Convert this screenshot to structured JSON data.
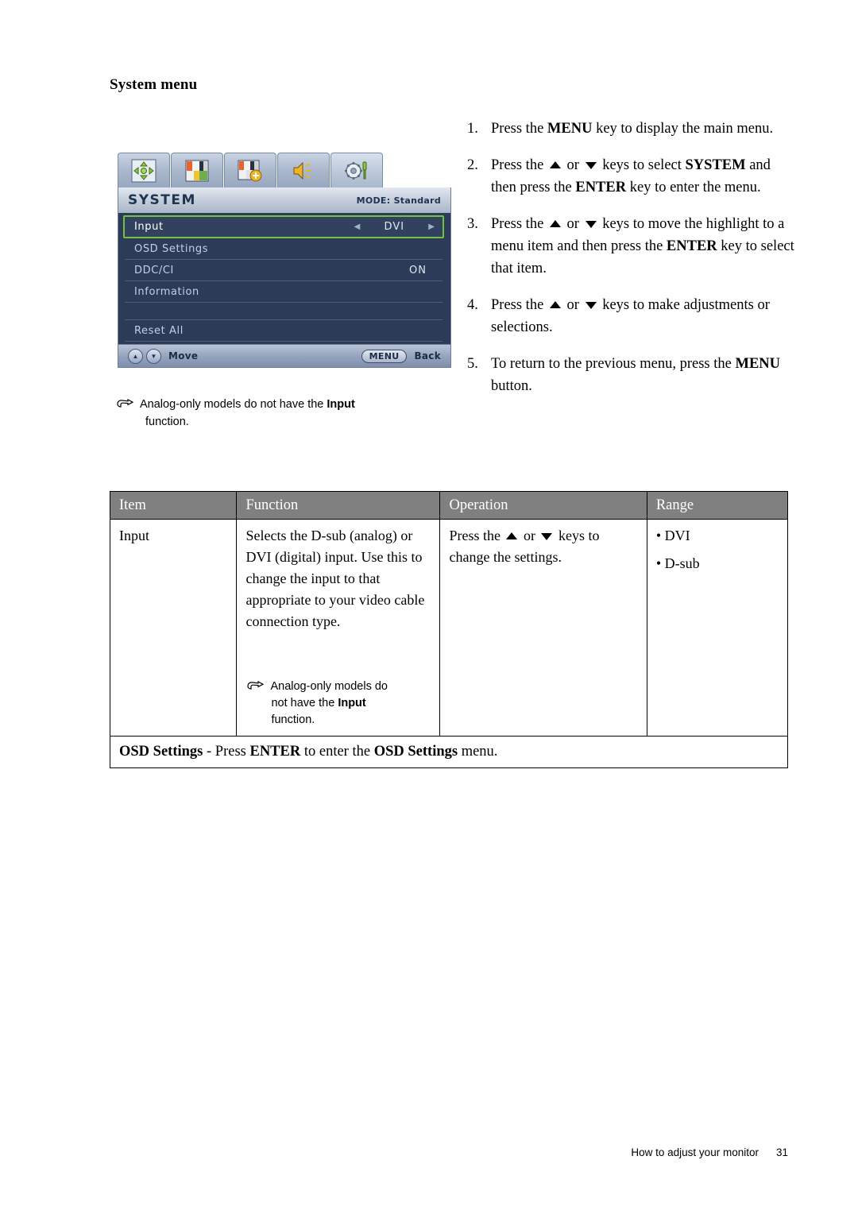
{
  "page": {
    "heading": "System menu",
    "footer_text": "How to adjust your monitor",
    "footer_page": "31"
  },
  "osd": {
    "tabs": [
      {
        "name": "display-position-icon",
        "label": "Display"
      },
      {
        "name": "picture-icon",
        "label": "Picture"
      },
      {
        "name": "picture-advanced-icon",
        "label": "Picture Advanced"
      },
      {
        "name": "audio-icon",
        "label": "Audio"
      },
      {
        "name": "system-icon",
        "label": "System"
      }
    ],
    "title": "SYSTEM",
    "mode": "MODE: Standard",
    "rows": [
      {
        "label": "Input",
        "value": "DVI",
        "selected": true,
        "arrows": true
      },
      {
        "label": "OSD Settings",
        "value": "",
        "selected": false,
        "arrows": false
      },
      {
        "label": "DDC/CI",
        "value": "ON",
        "selected": false,
        "arrows": false
      },
      {
        "label": "Information",
        "value": "",
        "selected": false,
        "arrows": false
      },
      {
        "label": "",
        "value": "",
        "selected": false,
        "arrows": false
      },
      {
        "label": "Reset All",
        "value": "",
        "selected": false,
        "arrows": false
      }
    ],
    "footer": {
      "up_glyph": "▲",
      "down_glyph": "▼",
      "move_label": "Move",
      "menu_label": "MENU",
      "back_label": "Back"
    },
    "colors": {
      "body_bg": "#2c3c58",
      "highlight": "#74c043",
      "text": "#c3cfe4"
    }
  },
  "note_under_image": {
    "line1_a": "Analog-only models do not have the ",
    "line1_bold": "Input",
    "line2": "function."
  },
  "steps": [
    {
      "num": "1.",
      "parts": [
        {
          "t": "Press the ",
          "s": "n"
        },
        {
          "t": "MENU",
          "s": "b"
        },
        {
          "t": " key to display the main menu.",
          "s": "n"
        }
      ]
    },
    {
      "num": "2.",
      "parts": [
        {
          "t": "Press the ",
          "s": "n"
        },
        {
          "t": "",
          "s": "up"
        },
        {
          "t": " or ",
          "s": "n"
        },
        {
          "t": "",
          "s": "dn"
        },
        {
          "t": " keys to select ",
          "s": "n"
        },
        {
          "t": "SYSTEM",
          "s": "b"
        },
        {
          "t": " and then press the ",
          "s": "n"
        },
        {
          "t": "ENTER",
          "s": "b"
        },
        {
          "t": " key to enter the menu.",
          "s": "n"
        }
      ]
    },
    {
      "num": "3.",
      "parts": [
        {
          "t": "Press the ",
          "s": "n"
        },
        {
          "t": "",
          "s": "up"
        },
        {
          "t": " or ",
          "s": "n"
        },
        {
          "t": "",
          "s": "dn"
        },
        {
          "t": " keys to move the highlight to a menu item and then press the ",
          "s": "n"
        },
        {
          "t": "ENTER",
          "s": "b"
        },
        {
          "t": " key to select that item.",
          "s": "n"
        }
      ]
    },
    {
      "num": "4.",
      "parts": [
        {
          "t": "Press the ",
          "s": "n"
        },
        {
          "t": "",
          "s": "up"
        },
        {
          "t": " or ",
          "s": "n"
        },
        {
          "t": "",
          "s": "dn"
        },
        {
          "t": " keys to make adjustments or selections.",
          "s": "n"
        }
      ]
    },
    {
      "num": "5.",
      "parts": [
        {
          "t": "To return to the previous menu, press the ",
          "s": "n"
        },
        {
          "t": "MENU",
          "s": "b"
        },
        {
          "t": " button.",
          "s": "n"
        }
      ]
    }
  ],
  "table": {
    "headers": [
      "Item",
      "Function",
      "Operation",
      "Range"
    ],
    "row": {
      "item": "Input",
      "function_text": "Selects the D-sub (analog) or DVI (digital) input. Use this to change the input to that appropriate to your video cable connection type.",
      "function_note": {
        "l1": "Analog-only models do",
        "l2_a": "not have the ",
        "l2_bold": "Input",
        "l3": "function."
      },
      "operation_parts": [
        {
          "t": "Press the ",
          "s": "n"
        },
        {
          "t": "",
          "s": "up"
        },
        {
          "t": " or ",
          "s": "n"
        },
        {
          "t": "",
          "s": "dn"
        },
        {
          "t": " keys to change the settings.",
          "s": "n"
        }
      ],
      "range": [
        "• DVI",
        "• D-sub"
      ]
    },
    "footer_row_parts": [
      {
        "t": "OSD Settings",
        "s": "b"
      },
      {
        "t": " - Press ",
        "s": "n"
      },
      {
        "t": "ENTER",
        "s": "b"
      },
      {
        "t": " to enter the ",
        "s": "n"
      },
      {
        "t": "OSD Settings",
        "s": "b"
      },
      {
        "t": " menu.",
        "s": "n"
      }
    ]
  }
}
